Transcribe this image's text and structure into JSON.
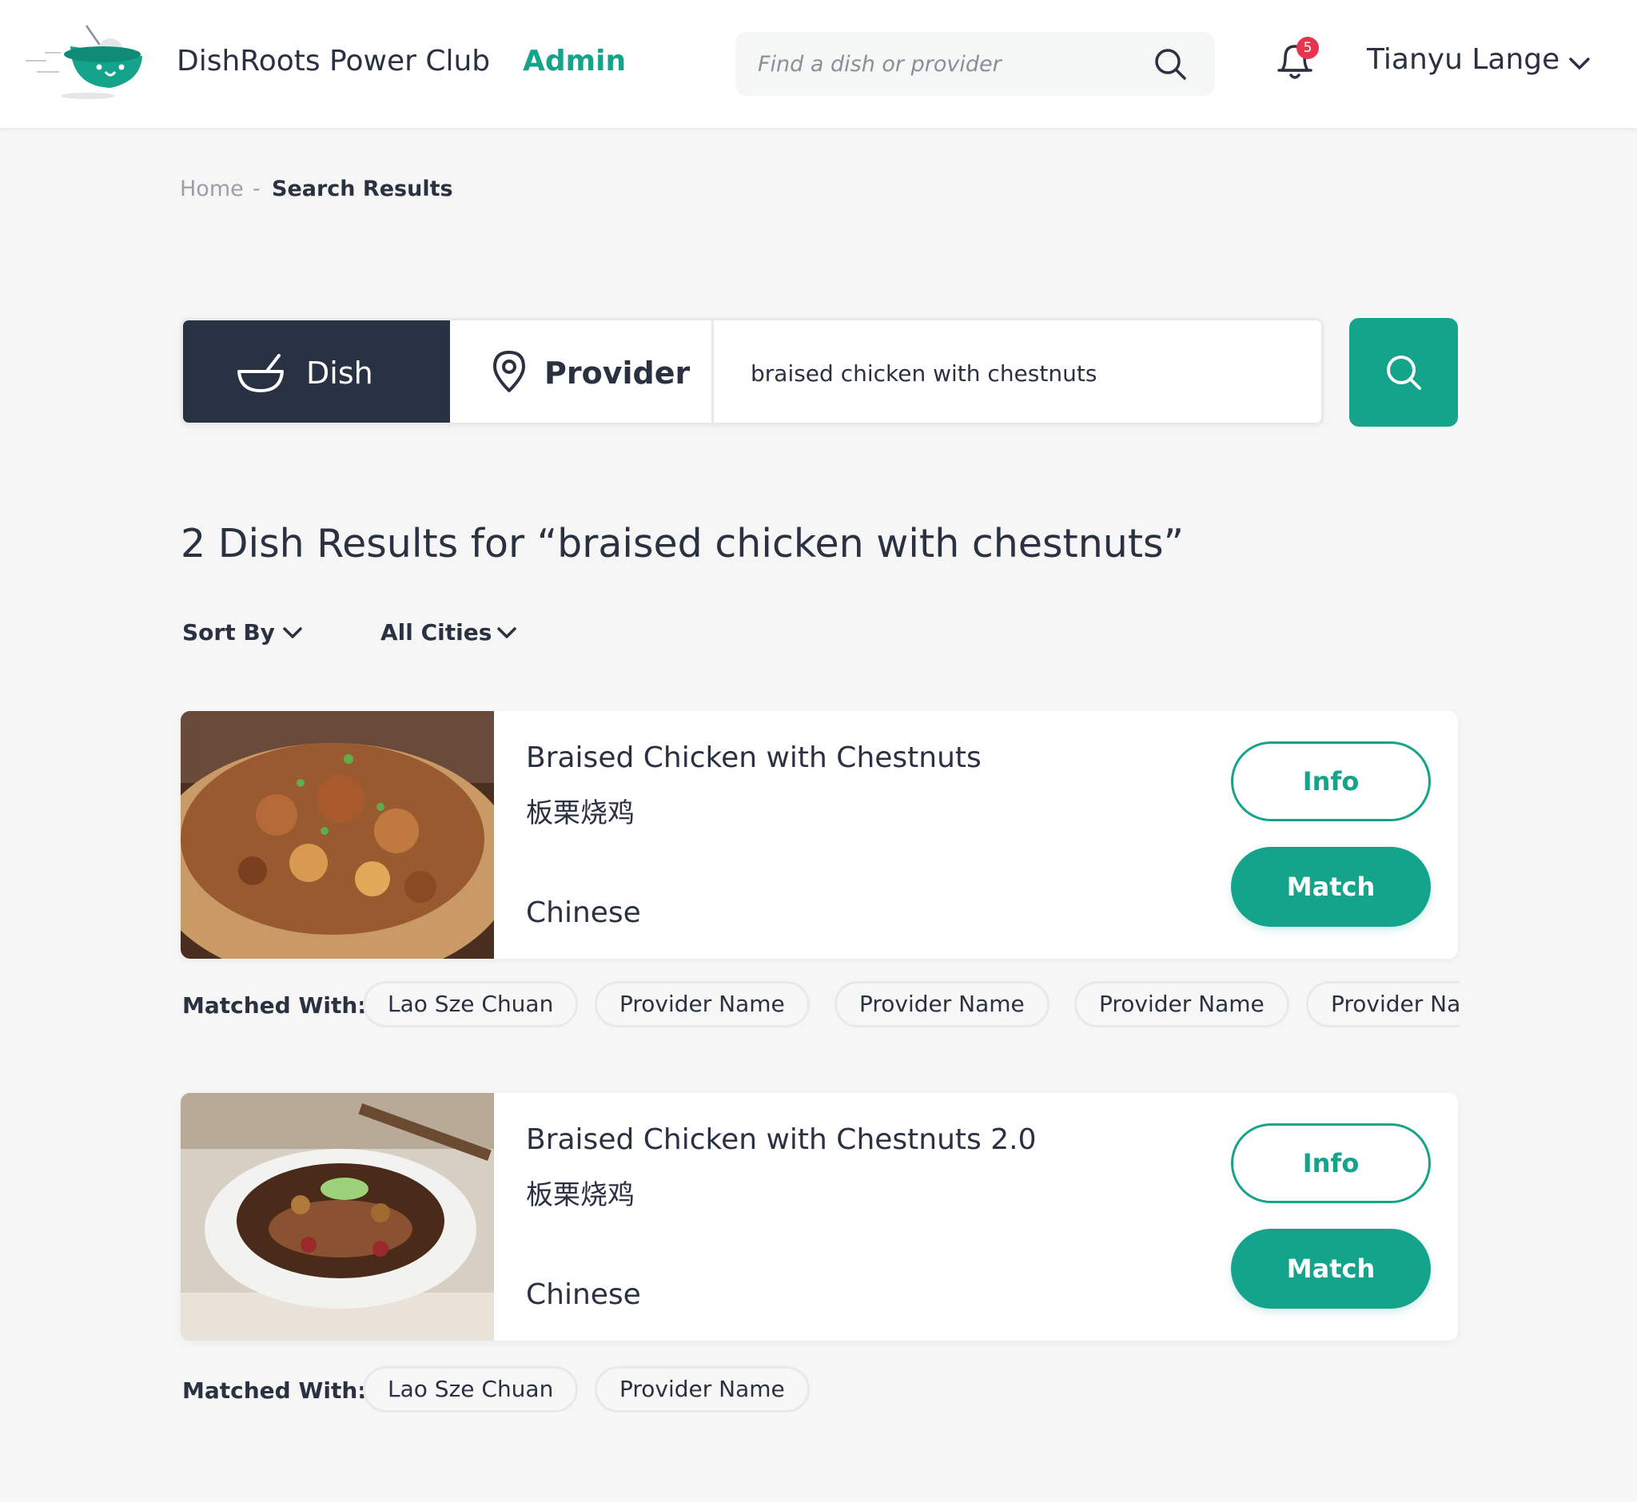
{
  "header": {
    "brand": "DishRoots Power Club",
    "role": "Admin",
    "search_placeholder": "Find a dish or provider",
    "notifications_count": "5",
    "user_name": "Tianyu Lange"
  },
  "breadcrumb": {
    "home": "Home",
    "separator": "-",
    "current": "Search Results"
  },
  "search": {
    "tabs": {
      "dish": "Dish",
      "provider": "Provider"
    },
    "active_tab": "Dish",
    "query": "braised chicken with chestnuts"
  },
  "results": {
    "heading": "2 Dish Results for “braised chicken with chestnuts”",
    "sort_label": "Sort By",
    "city_filter": "All Cities",
    "items": [
      {
        "name": "Braised Chicken with Chestnuts",
        "name_cn": "板栗烧鸡",
        "cuisine": "Chinese",
        "info_label": "Info",
        "match_label": "Match",
        "matched_label": "Matched With:",
        "matched_with": [
          "Lao Sze Chuan",
          "Provider Name",
          "Provider Name",
          "Provider Name",
          "Provider Name"
        ]
      },
      {
        "name": "Braised Chicken with Chestnuts 2.0",
        "name_cn": "板栗烧鸡",
        "cuisine": "Chinese",
        "info_label": "Info",
        "match_label": "Match",
        "matched_label": "Matched With:",
        "matched_with": [
          "Lao Sze Chuan",
          "Provider Name"
        ]
      }
    ]
  },
  "colors": {
    "accent": "#14a38b",
    "dark": "#283242",
    "badge": "#e8344e",
    "background": "#f6f6f6"
  }
}
